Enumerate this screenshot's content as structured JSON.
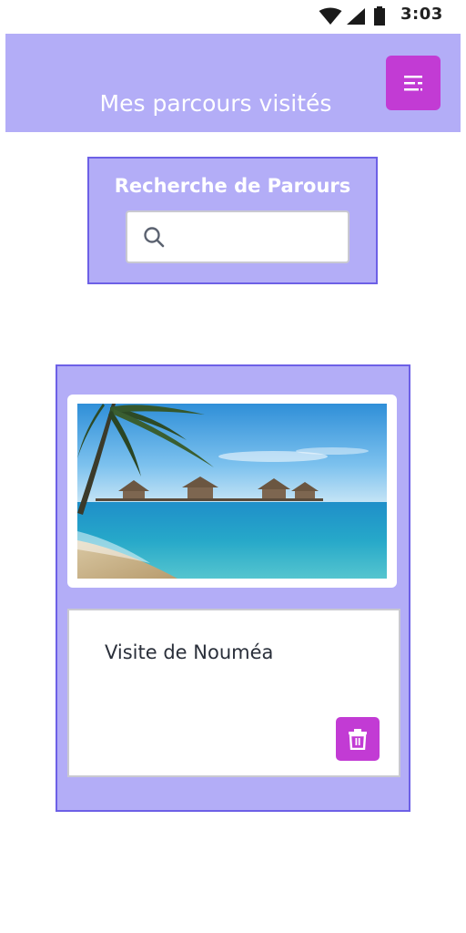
{
  "status_bar": {
    "time": "3:03",
    "icons": [
      "wifi-icon",
      "signal-icon",
      "battery-icon"
    ]
  },
  "header": {
    "title": "Mes parcours visités",
    "menu_icon": "filter-menu-icon"
  },
  "search": {
    "title": "Recherche de Parours",
    "value": "",
    "placeholder": "",
    "icon": "search-icon"
  },
  "cards": [
    {
      "image": "tropical beach with overwater bungalows",
      "title": "Visite de Nouméa",
      "delete_icon": "trash-icon"
    }
  ],
  "colors": {
    "accent_purple": "#b3adf7",
    "border_purple": "#6d60e6",
    "button_magenta": "#c23bd4"
  }
}
